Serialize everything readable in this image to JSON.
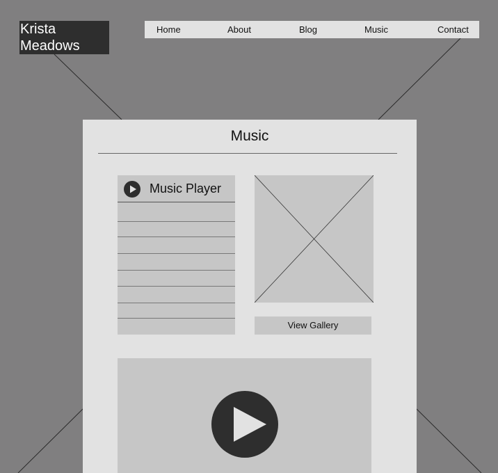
{
  "logo": {
    "line1": "Krista",
    "line2": "Meadows"
  },
  "nav": {
    "items": [
      {
        "label": "Home"
      },
      {
        "label": "About"
      },
      {
        "label": "Blog"
      },
      {
        "label": "Music"
      },
      {
        "label": "Contact"
      }
    ]
  },
  "main": {
    "title": "Music",
    "player": {
      "title": "Music Player",
      "icon": "play-icon"
    },
    "gallery": {
      "image_icon": "image-placeholder-icon",
      "button_label": "View Gallery"
    },
    "video": {
      "icon": "play-icon"
    }
  },
  "colors": {
    "background": "#807f80",
    "panel": "#e2e2e2",
    "placeholder": "#c6c6c6",
    "dark": "#2e2e2e"
  }
}
